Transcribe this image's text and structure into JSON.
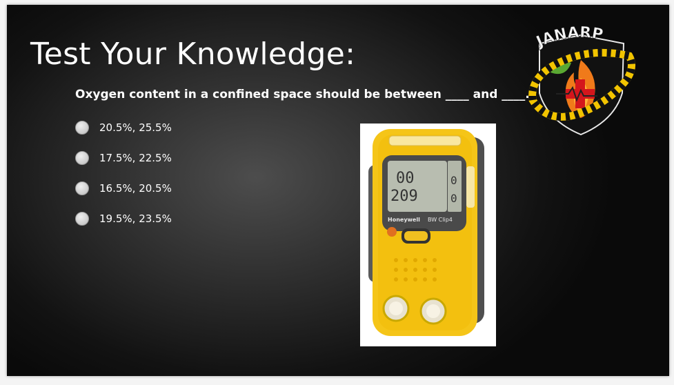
{
  "slide": {
    "title": "Test Your Knowledge:",
    "question": "Oxygen content in a confined space should be between ____ and ____.",
    "options": [
      {
        "label": "20.5%, 25.5%"
      },
      {
        "label": "17.5%, 22.5%"
      },
      {
        "label": "16.5%, 20.5%"
      },
      {
        "label": "19.5%, 23.5%"
      }
    ]
  },
  "logo": {
    "text": "JANARP",
    "colors": {
      "shield": "#111111",
      "stripe_yellow": "#f2c400",
      "flame": "#f07a1a",
      "cross": "#d4161c",
      "leaf": "#5aa832"
    }
  },
  "device": {
    "brand": "Honeywell",
    "model": "BW Clip4",
    "display_top": "00",
    "display_mid": "209",
    "display_right_top": "0",
    "display_right_mid": "0",
    "colors": {
      "body": "#f5c518",
      "trim": "#555555"
    }
  }
}
